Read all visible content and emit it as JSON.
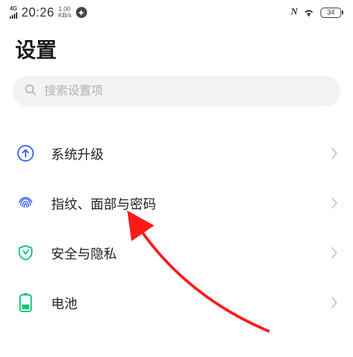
{
  "status": {
    "network_type": "4G",
    "time": "20:26",
    "speed_value": "1.00",
    "speed_unit": "KB/s",
    "nfc": "N",
    "battery": "34"
  },
  "page_title": "设置",
  "search": {
    "placeholder": "搜索设置项"
  },
  "items": [
    {
      "label": "系统升级"
    },
    {
      "label": "指纹、面部与密码"
    },
    {
      "label": "安全与隐私"
    },
    {
      "label": "电池"
    }
  ],
  "colors": {
    "upgrade": "#3a62ff",
    "fingerprint": "#3a62ff",
    "security": "#18c47a",
    "battery": "#18c47a"
  }
}
